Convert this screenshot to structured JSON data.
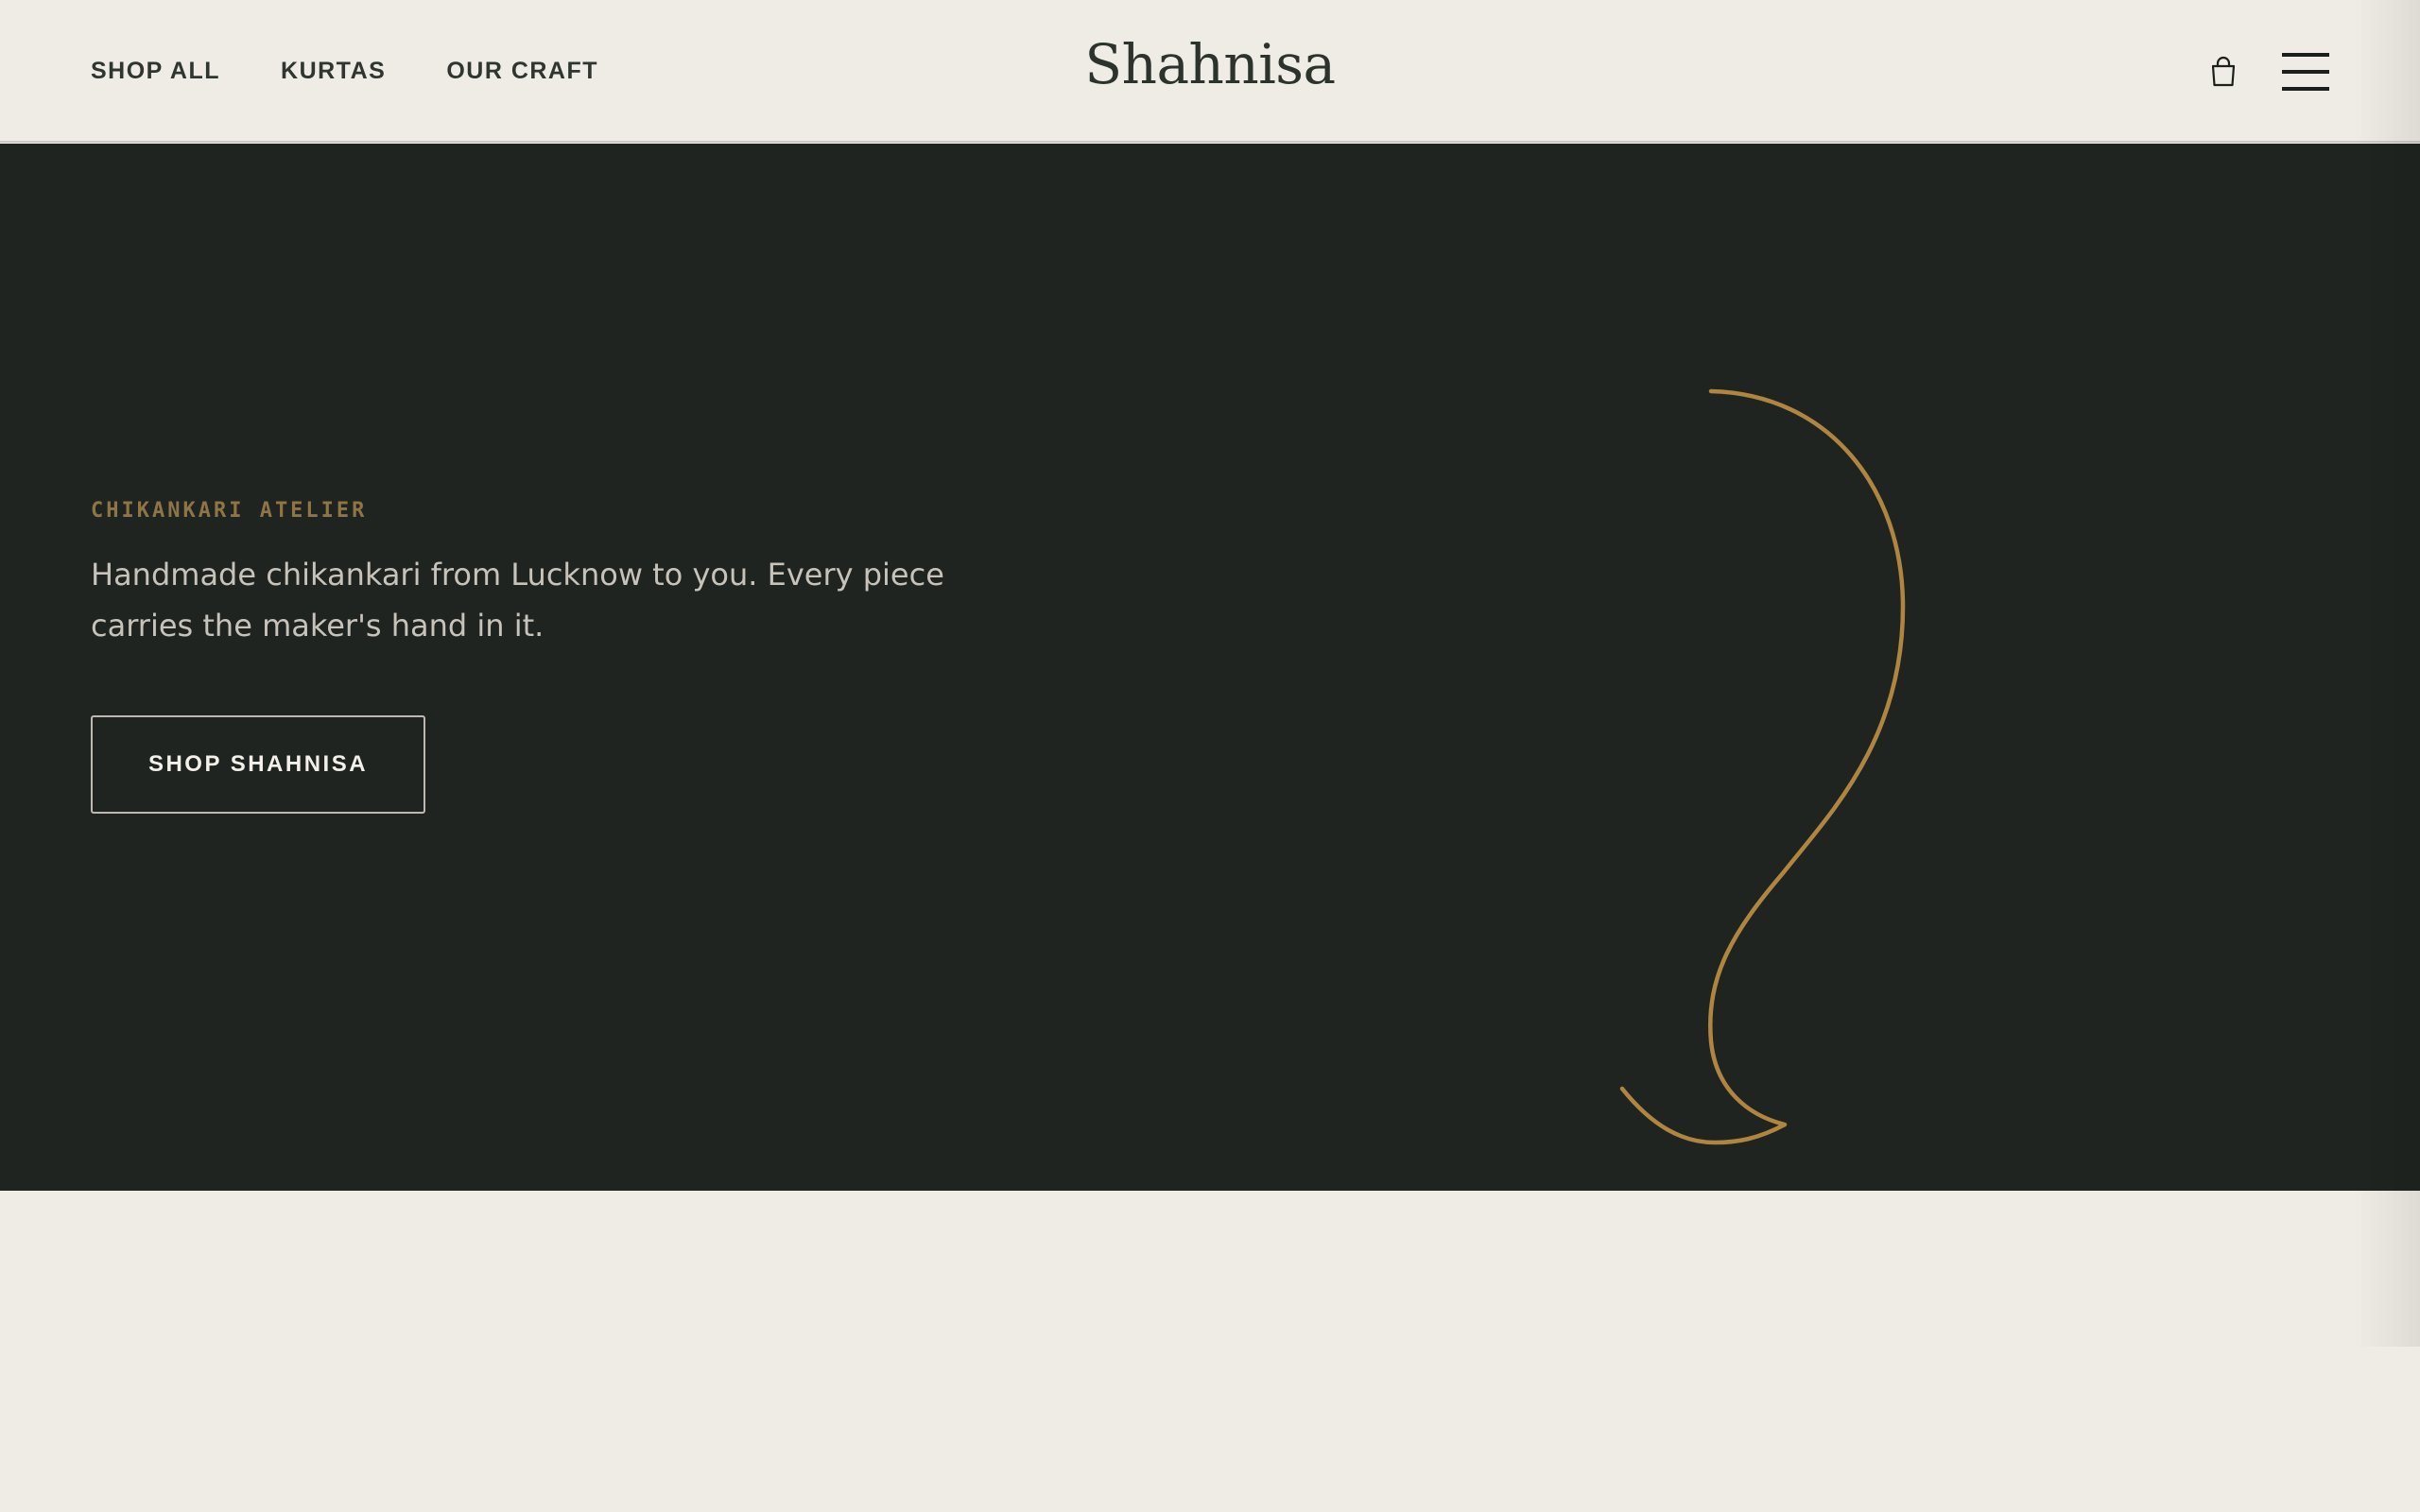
{
  "header": {
    "nav": [
      {
        "label": "SHOP ALL"
      },
      {
        "label": "KURTAS"
      },
      {
        "label": "OUR CRAFT"
      }
    ],
    "logo": "Shahnisa",
    "cart_icon": "shopping-bag-icon",
    "menu_icon": "hamburger-menu-icon"
  },
  "hero": {
    "eyebrow": "CHIKANKARI ATELIER",
    "tagline": "Handmade chikankari from Lucknow to you. Every piece carries the maker's hand in it.",
    "cta_label": "SHOP SHAHNISA",
    "ornament_icon": "paisley-flourish-icon"
  },
  "colors": {
    "page_background": "#efebe5",
    "hero_background": "#1f2420",
    "accent_gold": "#b0853f",
    "eyebrow_gold": "#8f7445",
    "text_dark": "#2f352f",
    "text_light": "#c7c3bb"
  }
}
